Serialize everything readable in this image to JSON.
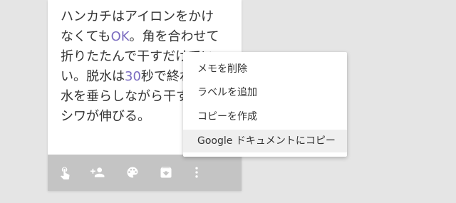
{
  "note": {
    "body_parts": [
      {
        "t": "ハンカチはアイロンをかけ\nなくても",
        "c": ""
      },
      {
        "t": "OK",
        "c": "num"
      },
      {
        "t": "。角を合わせて\n折りたたんで干すだけでい\nい。脱水は",
        "c": ""
      },
      {
        "t": "30",
        "c": "num"
      },
      {
        "t": "秒で終わらせ、\n水を垂らしながら干すと、\nシワが伸びる。",
        "c": ""
      }
    ]
  },
  "toolbar": {
    "icons": [
      "remind-me-icon",
      "collaborator-icon",
      "palette-icon",
      "archive-icon",
      "more-vert-icon"
    ]
  },
  "menu": {
    "items": [
      {
        "label": "メモを削除"
      },
      {
        "label": "ラベルを追加"
      },
      {
        "label": "コピーを作成"
      },
      {
        "label": "Google ドキュメントにコピー",
        "highlighted": true
      }
    ]
  },
  "colors": {
    "background": "#e5e5e5",
    "toolbar": "#c4c4c4",
    "menu_highlight": "#efefef",
    "number_accent": "#7b6cc0"
  }
}
